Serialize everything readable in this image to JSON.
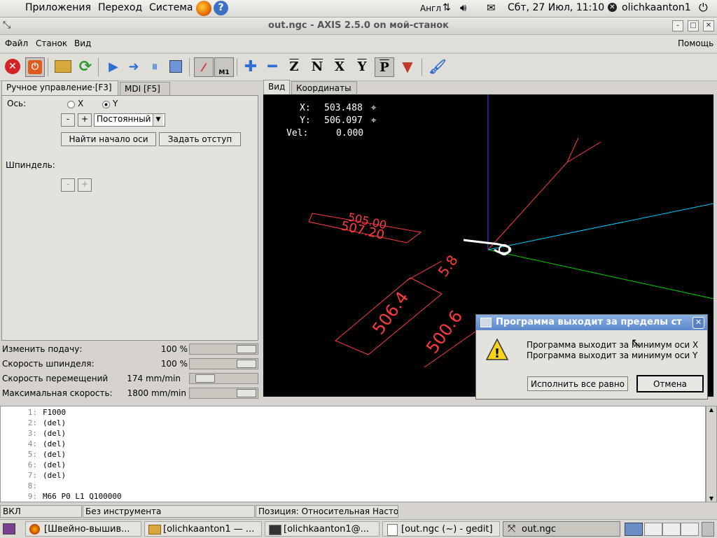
{
  "top_panel": {
    "menus": [
      "Приложения",
      "Переход",
      "Система"
    ],
    "keyboard_layout": "Англ",
    "datetime": "Сбт, 27 Июл, 11:10",
    "username": "olichkaanton1"
  },
  "window": {
    "title": "out.ngc - AXIS 2.5.0 on мой-станок"
  },
  "menubar": {
    "items": [
      "Файл",
      "Станок",
      "Вид"
    ],
    "help": "Помощь"
  },
  "toolbar": {
    "x_label": "X",
    "y_label": "Y",
    "z_label": "Z",
    "n_label": "N",
    "p_label": "P",
    "m1_label": "M1"
  },
  "left_tabs": [
    "Ручное управление·[F3]",
    "MDI [F5]"
  ],
  "manual": {
    "axis_label": "Ось:",
    "axis_x": "X",
    "axis_y": "Y",
    "minus": "-",
    "plus": "+",
    "jog_mode": "Постоянный",
    "home_button": "Найти начало оси",
    "offset_button": "Задать отступ",
    "spindle_label": "Шпиндель:",
    "spindle_minus": "-",
    "spindle_plus": "+"
  },
  "overrides": [
    {
      "label": "Изменить подачу:",
      "value": "100 %",
      "level": 1.0
    },
    {
      "label": "Скорость шпинделя:",
      "value": "100 %",
      "level": 1.0
    },
    {
      "label": "Скорость перемещений",
      "value": "174 mm/min",
      "level": 0.12
    },
    {
      "label": "Максимальная скорость:",
      "value": "1800 mm/min",
      "level": 1.0
    }
  ],
  "right_tabs": [
    "Вид",
    "Координаты"
  ],
  "preview": {
    "dro": [
      {
        "label": "X:",
        "value": "503.488"
      },
      {
        "label": "Y:",
        "value": "506.097"
      },
      {
        "label": "Vel:",
        "value": "0.000"
      }
    ],
    "dims": [
      "505.00",
      "507.20",
      "506.4",
      "5.8",
      "500.6"
    ],
    "colors": {
      "background": "#000000",
      "extents": "#ff3b3b",
      "x_axis": "#00cc00",
      "y_axis": "#00ccff",
      "z_axis": "#3355ff",
      "tool": "#ffffff"
    }
  },
  "gcode": [
    {
      "n": "1:",
      "text": "F1000"
    },
    {
      "n": "2:",
      "text": "(del)"
    },
    {
      "n": "3:",
      "text": "(del)"
    },
    {
      "n": "4:",
      "text": "(del)"
    },
    {
      "n": "5:",
      "text": "(del)"
    },
    {
      "n": "6:",
      "text": "(del)"
    },
    {
      "n": "7:",
      "text": "(del)"
    },
    {
      "n": "8:",
      "text": ""
    },
    {
      "n": "9:",
      "text": "M66 P0 L1 Q100000"
    }
  ],
  "status": {
    "state": "ВКЛ",
    "tool": "Без инструмента",
    "position": "Позиция: Относительная Насто"
  },
  "dialog": {
    "title": "Программа выходит за пределы ст",
    "line1": "Программа выходит за минимум оси X",
    "line2": "Программа выходит за минимум оси Y",
    "run_anyway": "Исполнить все равно",
    "cancel": "Отмена"
  },
  "taskbar": {
    "items": [
      "[Швейно-вышив...",
      "[olichkaanton1 — ...",
      "[olichkaanton1@...",
      "[out.ngc (~) - gedit]",
      "out.ngc"
    ]
  }
}
